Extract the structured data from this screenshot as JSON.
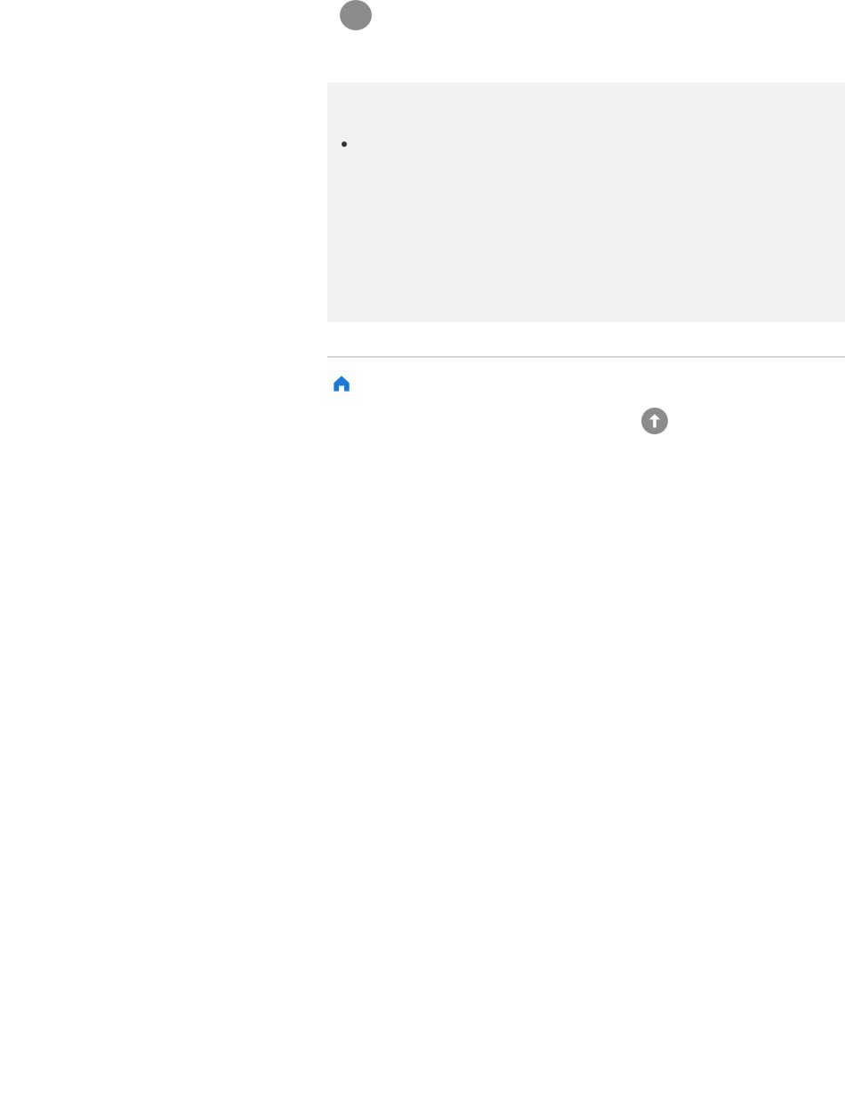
{
  "step": {
    "number": ""
  },
  "note": {
    "items": [
      {
        "text": ""
      }
    ]
  },
  "footer": {
    "home_icon": "home-icon",
    "top_icon": "arrow-up-circle-icon"
  },
  "colors": {
    "step_circle": "#8c8c8c",
    "note_background": "#f2f2f2",
    "divider": "#d6d6d6",
    "home_icon": "#1a7ad8",
    "top_icon": "#8c8c8c"
  }
}
